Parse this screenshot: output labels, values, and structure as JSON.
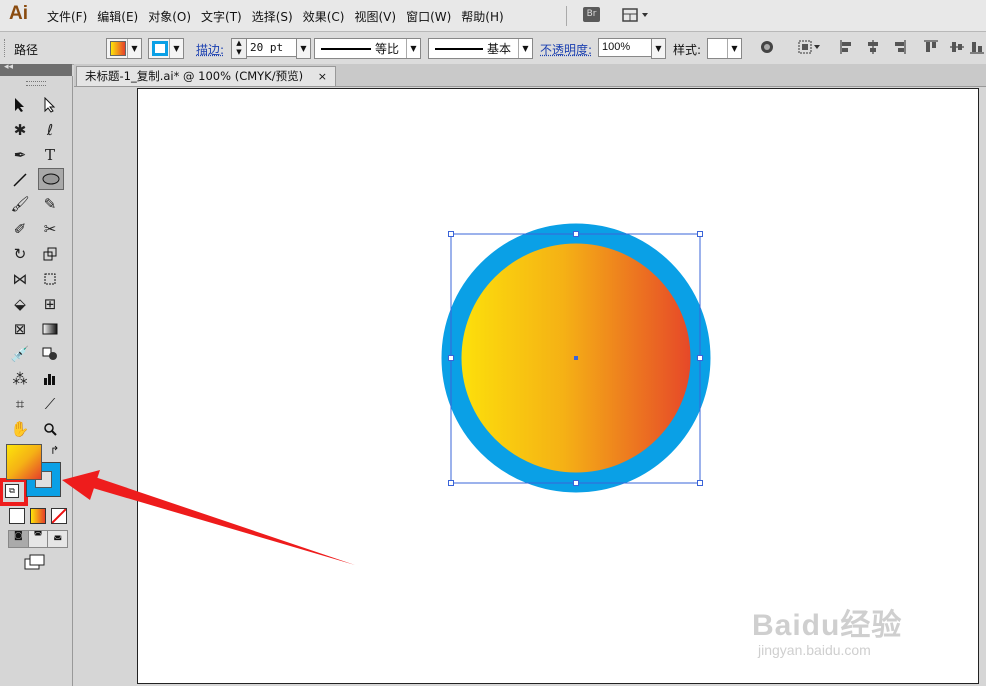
{
  "app": {
    "logo": "Ai",
    "br_label": "Br"
  },
  "menu": [
    "文件(F)",
    "编辑(E)",
    "对象(O)",
    "文字(T)",
    "选择(S)",
    "效果(C)",
    "视图(V)",
    "窗口(W)",
    "帮助(H)"
  ],
  "control_bar": {
    "selection_type": "路径",
    "stroke_label": "描边:",
    "stroke_weight": "20 pt",
    "profile_label": "等比",
    "brush_label": "基本",
    "opacity_label": "不透明度:",
    "opacity_value": "100%",
    "style_label": "样式:"
  },
  "document_tab": {
    "title": "未标题-1_复制.ai* @ 100% (CMYK/预览)",
    "close": "×"
  },
  "colors": {
    "fill_gradient_start": "#fde40a",
    "fill_gradient_mid": "#f5b115",
    "fill_gradient_end": "#e5402a",
    "stroke": "#0aa0e6",
    "selection": "#3a64d8",
    "arrow": "#ee1c1c",
    "highlight_box": "#ee1c1c"
  },
  "canvas": {
    "object_type": "ellipse",
    "stroke_weight_pt": 20
  },
  "watermark": {
    "brand": "Baidu经验",
    "url": "jingyan.baidu.com"
  }
}
